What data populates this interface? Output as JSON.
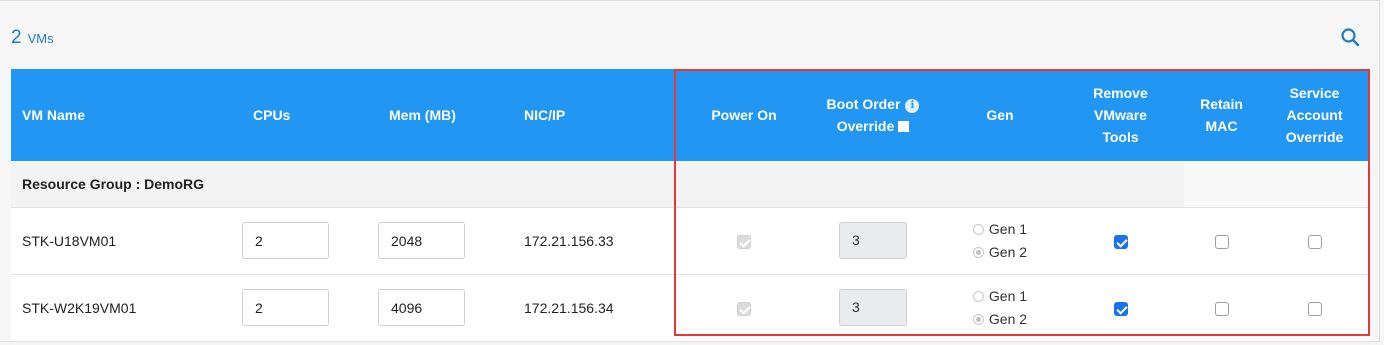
{
  "summary": {
    "count": "2",
    "unit": "VMs"
  },
  "columns": {
    "vm_name": "VM Name",
    "cpus": "CPUs",
    "mem": "Mem (MB)",
    "nic": "NIC/IP",
    "power_on": "Power On",
    "boot_order_line1": "Boot Order",
    "boot_order_line2": "Override",
    "gen": "Gen",
    "remove_line1": "Remove",
    "remove_line2": "VMware",
    "remove_line3": "Tools",
    "retain_line1": "Retain",
    "retain_line2": "MAC",
    "service_line1": "Service",
    "service_line2": "Account",
    "service_line3": "Override"
  },
  "group": {
    "label": "Resource Group : DemoRG"
  },
  "rows": [
    {
      "name": "STK-U18VM01",
      "cpus": "2",
      "mem": "2048",
      "nic": "172.21.156.33",
      "power_on": true,
      "boot_order": "3",
      "gen1": "Gen 1",
      "gen2": "Gen 2",
      "gen_selected": "Gen 2",
      "remove_vmware_tools": true,
      "retain_mac": false,
      "service_account_override": false
    },
    {
      "name": "STK-W2K19VM01",
      "cpus": "2",
      "mem": "4096",
      "nic": "172.21.156.34",
      "power_on": true,
      "boot_order": "3",
      "gen1": "Gen 1",
      "gen2": "Gen 2",
      "gen_selected": "Gen 2",
      "remove_vmware_tools": true,
      "retain_mac": false,
      "service_account_override": false
    }
  ],
  "icons": {
    "search": "search-icon",
    "info": "info-icon"
  },
  "colors": {
    "header_bg": "#2196f3",
    "accent": "#1e7bc6",
    "highlight": "#e53935",
    "checked": "#1a73e8"
  }
}
